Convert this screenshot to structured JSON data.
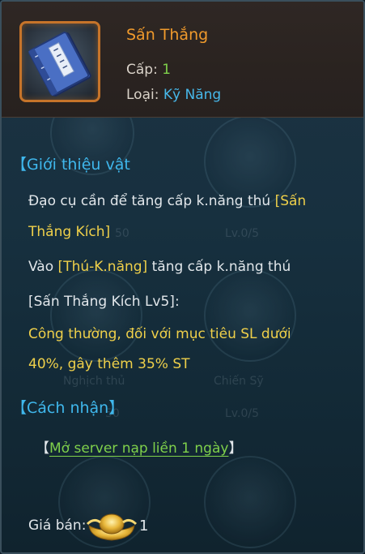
{
  "item": {
    "name": "Sấn Thắng",
    "level_label": "Cấp:",
    "level_value": "1",
    "type_label": "Loại:",
    "type_value": "Kỹ Năng",
    "icon": "skill-book-icon"
  },
  "intro": {
    "heading": "【Giới thiệu vật",
    "line1_a": "Đạo cụ cần để tăng cấp k.năng thú ",
    "line1_b": "[Sấn",
    "line2": "Thắng Kích]",
    "line3_a": "Vào ",
    "line3_b": "[Thú-K.năng]",
    "line3_c": " tăng cấp k.năng thú",
    "line4": "[Sấn Thắng Kích Lv5]:",
    "line5": "Công thường, đối với mục tiêu SL dưới",
    "line6": "40%, gây thêm 35% ST"
  },
  "obtain": {
    "heading": "【Cách nhận】",
    "bracket_open": "【",
    "link": "Mở server nạp liền 1 ngày",
    "bracket_close": "】"
  },
  "price": {
    "label": "Giá bán:",
    "value": "1",
    "icon": "gold-ingot-icon"
  },
  "colors": {
    "name": "#f09a2c",
    "section": "#3fb7ec",
    "highlight": "#efd04a",
    "green": "#7fd14b",
    "blue": "#47b8ea"
  },
  "background_ghost": {
    "t1": "50",
    "t2": "Lv.0/5",
    "t3": "Nghịch thủ",
    "t4": "Chiến Sỹ",
    "t5": "Lv.0/5",
    "t6": "50"
  }
}
